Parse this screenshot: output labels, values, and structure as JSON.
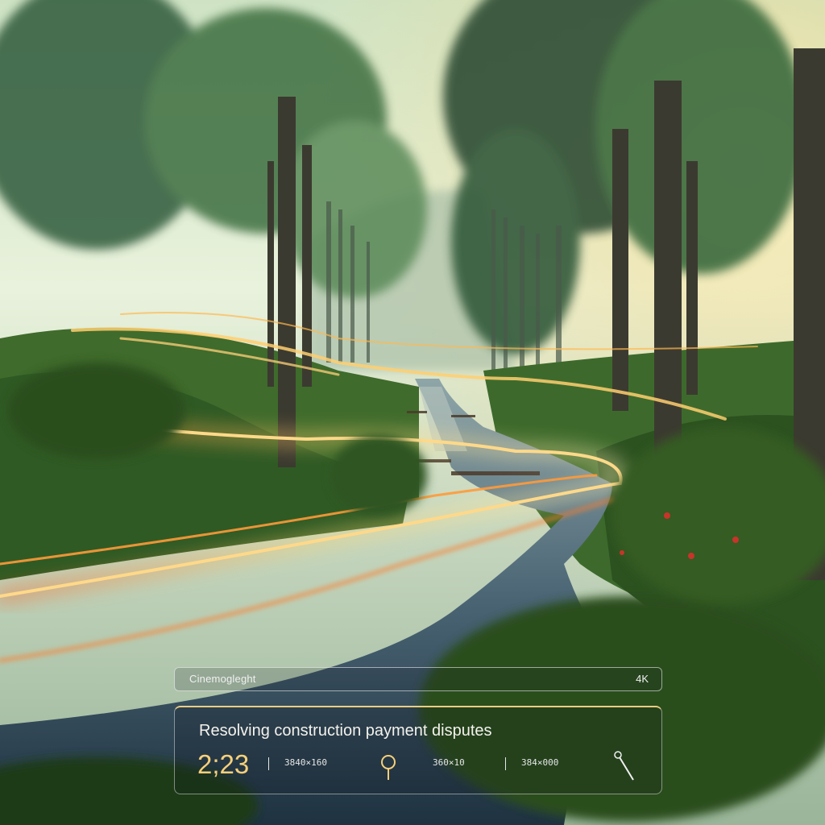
{
  "overlay": {
    "brand": "Cinemogleght",
    "resolution": "4K",
    "title": "Resolving construction payment disputes",
    "time": "2;23",
    "meta_1": "3840×160",
    "meta_2": "360×10",
    "meta_3": "384×000"
  },
  "icons": [
    "location-pin-icon",
    "magic-wand-icon"
  ],
  "colors": {
    "light_trail": "#ffb347",
    "foliage": "#3f6b2c",
    "sky": "#e9f2dc",
    "water": "#324a5c"
  }
}
